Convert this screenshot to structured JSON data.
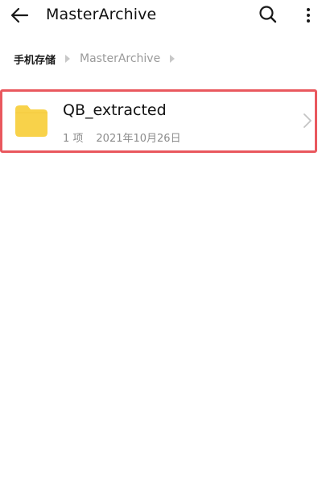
{
  "appbar": {
    "back_icon": "arrow-left-icon",
    "title": "MasterArchive",
    "search_icon": "search-icon",
    "more_icon": "more-vertical-icon"
  },
  "breadcrumb": {
    "root": "手机存储",
    "current": "MasterArchive",
    "separator_icon": "caret-right-icon"
  },
  "files": [
    {
      "icon": "folder-icon",
      "name": "QB_extracted",
      "item_count": "1 项",
      "date": "2021年10月26日",
      "chevron_icon": "chevron-right-icon"
    }
  ],
  "colors": {
    "folder": "#f8d24a",
    "highlight_border": "#e9585e",
    "secondary_text": "#8c8c8c",
    "separator": "#c8c8c8"
  }
}
